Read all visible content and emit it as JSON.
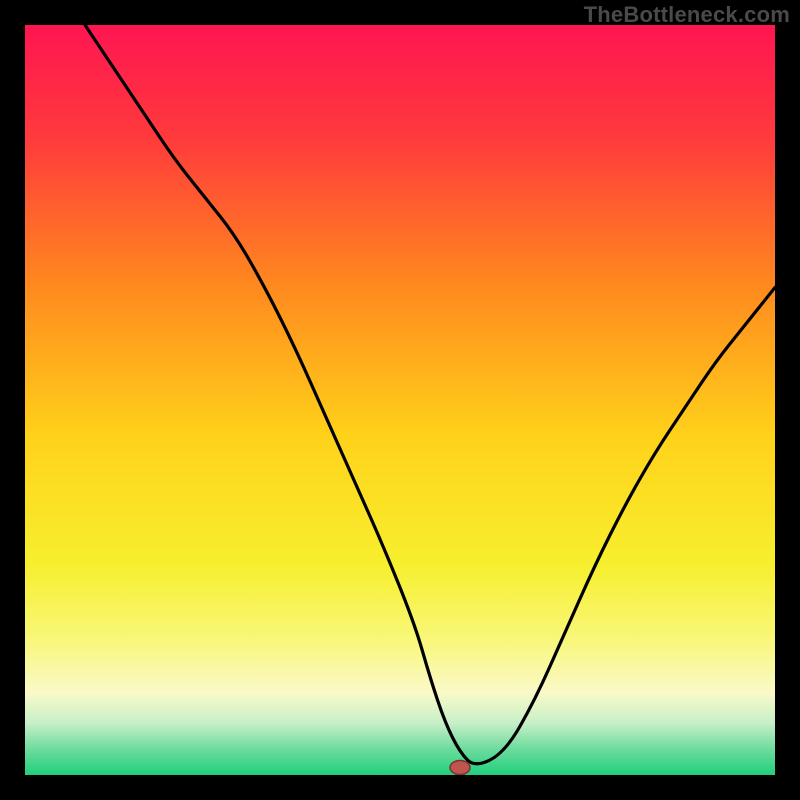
{
  "watermark": "TheBottleneck.com",
  "colors": {
    "frame_bg": "#000000",
    "gradient_stops": [
      {
        "offset": 0.0,
        "color": "#ff1552"
      },
      {
        "offset": 0.15,
        "color": "#ff3a3c"
      },
      {
        "offset": 0.35,
        "color": "#ff8a1e"
      },
      {
        "offset": 0.55,
        "color": "#ffd21a"
      },
      {
        "offset": 0.72,
        "color": "#f7ef2e"
      },
      {
        "offset": 0.82,
        "color": "#f8f77a"
      },
      {
        "offset": 0.89,
        "color": "#faf9c8"
      },
      {
        "offset": 0.93,
        "color": "#c8f0c8"
      },
      {
        "offset": 0.965,
        "color": "#6edc9e"
      },
      {
        "offset": 1.0,
        "color": "#1fcf7c"
      }
    ],
    "curve": "#000000",
    "marker_fill": "#c0544e",
    "marker_stroke": "#7a332f"
  },
  "chart_data": {
    "type": "line",
    "title": "",
    "xlabel": "",
    "ylabel": "",
    "xlim": [
      0,
      100
    ],
    "ylim": [
      0,
      100
    ],
    "x": [
      8,
      12,
      16,
      20,
      24,
      28,
      32,
      36,
      40,
      44,
      48,
      52,
      54,
      56,
      58,
      60,
      64,
      68,
      72,
      76,
      80,
      84,
      88,
      92,
      96,
      100
    ],
    "values": [
      100,
      94,
      88,
      82,
      77,
      72,
      65,
      57,
      48,
      39,
      30,
      20,
      13,
      7,
      3,
      1,
      3,
      10,
      19,
      28,
      36,
      43,
      49,
      55,
      60,
      65
    ],
    "marker": {
      "x": 58,
      "y": 1
    },
    "notes": "x and y are in percent of plot width/height; y=0 is the bottom (green), y=100 is the top (red). Curve shows bottleneck percentage; minimum near x≈58."
  }
}
